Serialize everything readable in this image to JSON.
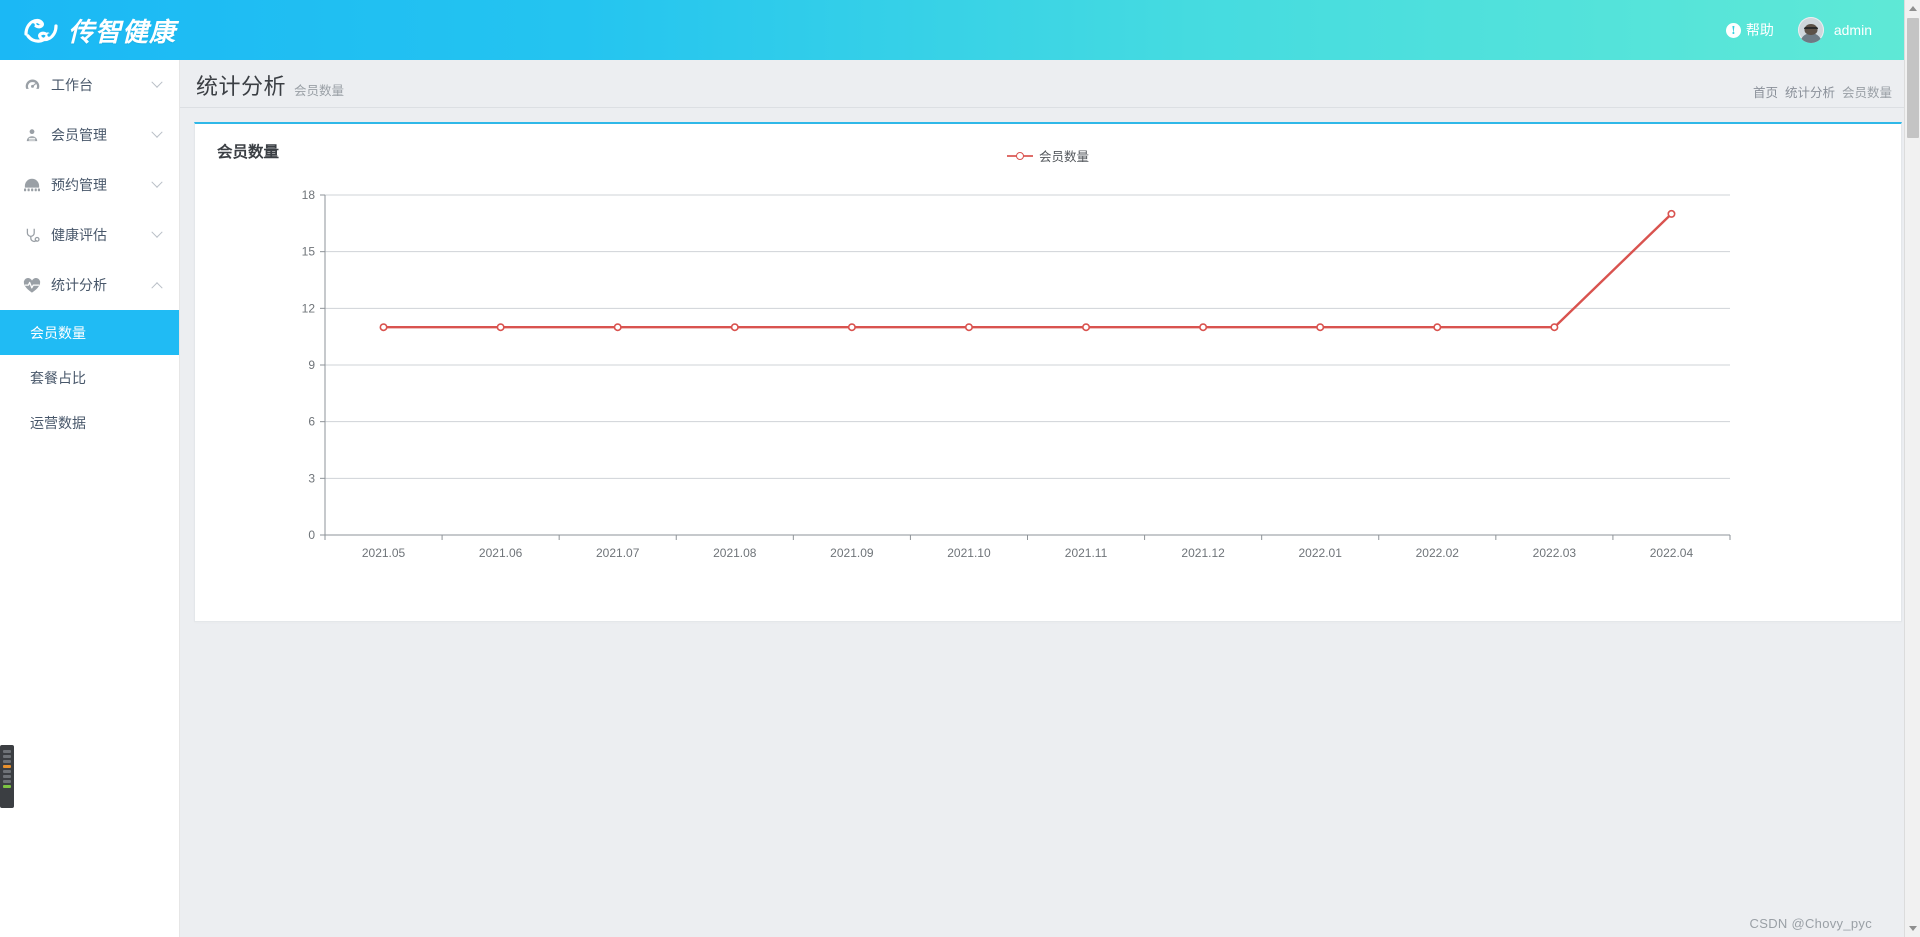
{
  "header": {
    "logo_text": "传智健康",
    "logo_icon": "yin-yang-fish-icon",
    "help_label": "帮助",
    "help_icon": "info-circle-icon",
    "username": "admin",
    "avatar_icon": "user-avatar-photo"
  },
  "sidebar": {
    "items": [
      {
        "label": "工作台",
        "icon": "dashboard-icon",
        "expanded": false
      },
      {
        "label": "会员管理",
        "icon": "user-member-icon",
        "expanded": false
      },
      {
        "label": "预约管理",
        "icon": "calendar-icon",
        "expanded": false
      },
      {
        "label": "健康评估",
        "icon": "stethoscope-icon",
        "expanded": false
      },
      {
        "label": "统计分析",
        "icon": "heart-pulse-icon",
        "expanded": true
      }
    ],
    "submenu": [
      {
        "label": "会员数量",
        "active": true
      },
      {
        "label": "套餐占比",
        "active": false
      },
      {
        "label": "运营数据",
        "active": false
      }
    ]
  },
  "page": {
    "title": "统计分析",
    "subtitle": "会员数量",
    "breadcrumb": [
      "首页",
      "统计分析",
      "会员数量"
    ]
  },
  "card": {
    "title": "会员数量"
  },
  "watermark": "CSDN @Chovy_pyc",
  "colors": {
    "brand_blue": "#20bbf4",
    "header_gradient_start": "#1bb8f5",
    "header_gradient_end": "#5fe9d6",
    "series_red": "#d9534f",
    "card_top_border": "#2fb8e8",
    "page_bg": "#eceef1"
  },
  "chart_data": {
    "type": "line",
    "title": "会员数量",
    "xlabel": "",
    "ylabel": "",
    "ylim": [
      0,
      18
    ],
    "yticks": [
      0,
      3,
      6,
      9,
      12,
      15,
      18
    ],
    "grid": true,
    "legend": [
      "会员数量"
    ],
    "legend_position": "top-center",
    "marker": "hollow-circle",
    "categories": [
      "2021.05",
      "2021.06",
      "2021.07",
      "2021.08",
      "2021.09",
      "2021.10",
      "2021.11",
      "2021.12",
      "2022.01",
      "2022.02",
      "2022.03",
      "2022.04"
    ],
    "series": [
      {
        "name": "会员数量",
        "color": "#d9534f",
        "values": [
          11,
          11,
          11,
          11,
          11,
          11,
          11,
          11,
          11,
          11,
          11,
          17
        ]
      }
    ]
  }
}
